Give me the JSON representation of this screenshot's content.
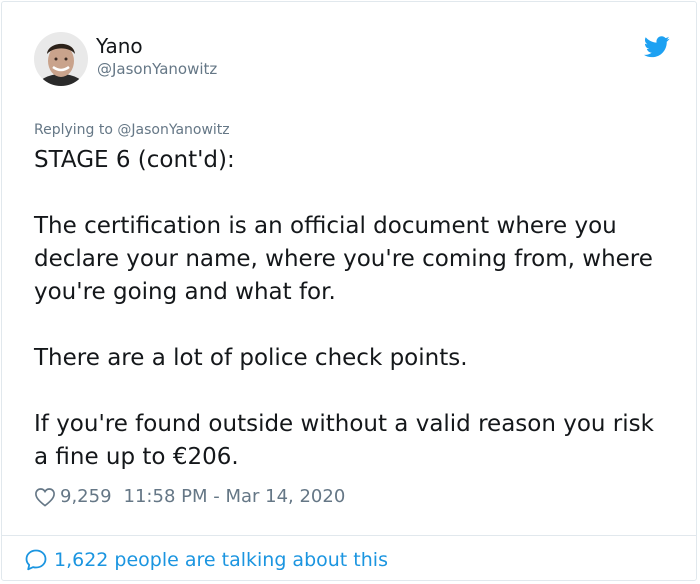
{
  "author": {
    "name": "Yano",
    "handle": "@JasonYanowitz"
  },
  "tweet": {
    "replying_to": "Replying to @JasonYanowitz",
    "paragraphs": [
      "STAGE 6 (cont'd):",
      "The certification is an official document where you declare your name, where you're coming from, where you're going and what for.",
      "There are a lot of police check points.",
      "If you're found outside without a valid reason you risk a fine up to €206."
    ],
    "likes": "9,259",
    "timestamp": "11:58 PM - Mar 14, 2020"
  },
  "footer": {
    "conversation_label": "1,622 people are talking about this"
  },
  "colors": {
    "brand": "#1da1f2",
    "link": "#1b95e0",
    "secondary_text": "#657786",
    "primary_text": "#14171a"
  },
  "icons": [
    "twitter-bird-icon",
    "heart-icon",
    "speech-bubble-icon"
  ]
}
